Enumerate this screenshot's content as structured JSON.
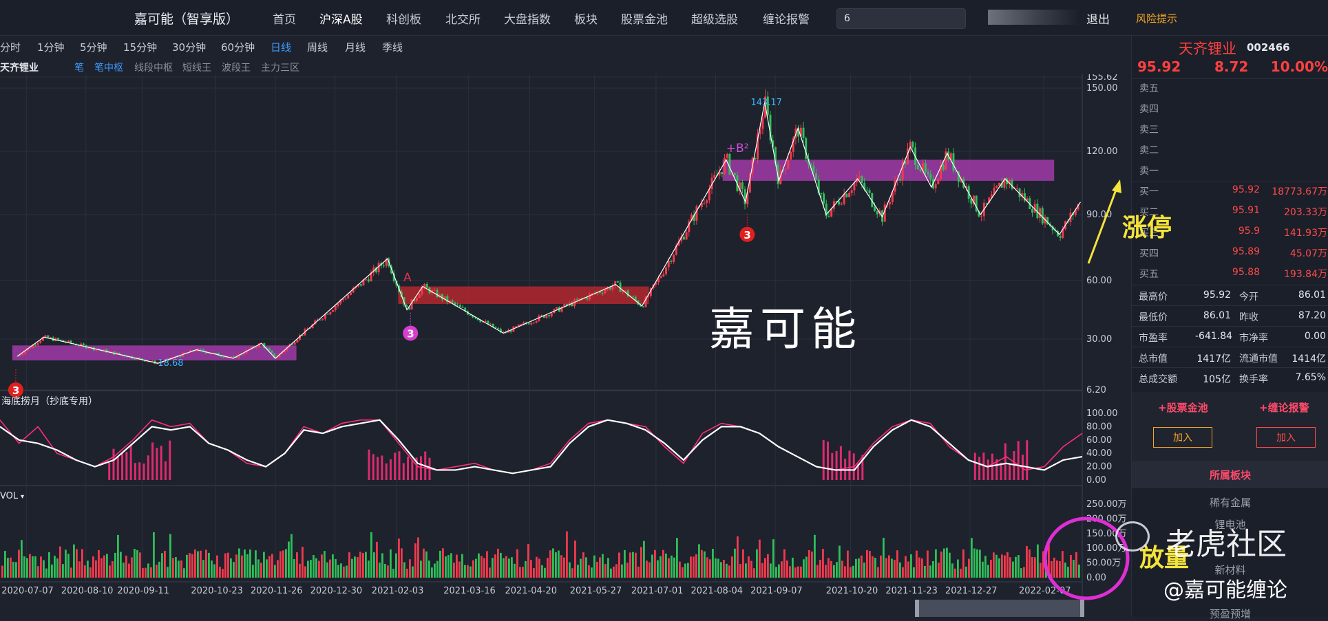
{
  "header": {
    "brand": "嘉可能（智享版）",
    "nav": [
      "首页",
      "沪深A股",
      "科创板",
      "北交所",
      "大盘指数",
      "板块",
      "股票金池",
      "超级选股",
      "缠论报警"
    ],
    "active_nav": "沪深A股",
    "search_value": "6",
    "logout": "退出",
    "risk": "风险提示"
  },
  "periods": [
    "分时",
    "1分钟",
    "5分钟",
    "15分钟",
    "30分钟",
    "60分钟",
    "日线",
    "周线",
    "月线",
    "季线"
  ],
  "active_period": "日线",
  "indicator_bar": {
    "stock": "天齐锂业",
    "items": [
      "笔",
      "笔中枢",
      "线段中枢",
      "短线王",
      "波段王",
      "主力三区"
    ],
    "active": [
      "笔",
      "笔中枢"
    ]
  },
  "chart_data": [
    {
      "type": "candlestick",
      "title": "天齐锂业",
      "y_ticks": [
        "155.62",
        "150.00",
        "120.00",
        "90.00",
        "60.00",
        "30.00",
        "6.20"
      ],
      "y_tick_values": [
        155.62,
        150,
        120,
        90,
        60,
        30,
        6.2
      ],
      "bi_points": [
        {
          "date": "2020-07-02",
          "price": 22
        },
        {
          "date": "2020-07-17",
          "price": 31
        },
        {
          "date": "2020-09-20",
          "price": 18.68
        },
        {
          "date": "2020-10-12",
          "price": 25
        },
        {
          "date": "2020-11-02",
          "price": 21
        },
        {
          "date": "2020-11-18",
          "price": 28
        },
        {
          "date": "2020-11-26",
          "price": 21
        },
        {
          "date": "2021-01-29",
          "price": 70
        },
        {
          "date": "2021-02-09",
          "price": 45
        },
        {
          "date": "2021-02-18",
          "price": 57
        },
        {
          "date": "2021-04-05",
          "price": 33
        },
        {
          "date": "2021-06-08",
          "price": 58
        },
        {
          "date": "2021-06-23",
          "price": 47
        },
        {
          "date": "2021-08-10",
          "price": 116
        },
        {
          "date": "2021-08-21",
          "price": 96
        },
        {
          "date": "2021-09-01",
          "price": 143.17
        },
        {
          "date": "2021-09-09",
          "price": 106
        },
        {
          "date": "2021-09-20",
          "price": 131
        },
        {
          "date": "2021-10-06",
          "price": 90
        },
        {
          "date": "2021-10-24",
          "price": 107
        },
        {
          "date": "2021-11-07",
          "price": 89
        },
        {
          "date": "2021-11-23",
          "price": 122
        },
        {
          "date": "2021-12-05",
          "price": 103
        },
        {
          "date": "2021-12-14",
          "price": 119
        },
        {
          "date": "2022-01-02",
          "price": 90
        },
        {
          "date": "2022-01-16",
          "price": 107
        },
        {
          "date": "2022-02-16",
          "price": 81
        },
        {
          "date": "2022-02-28",
          "price": 95.92
        }
      ],
      "zones": [
        {
          "start": "2020-06-29",
          "end": "2020-12-08",
          "low": 20,
          "high": 27,
          "color": "#a13aa8"
        },
        {
          "start": "2021-02-04",
          "end": "2021-06-27",
          "low": 48,
          "high": 57,
          "color": "#b1272f"
        },
        {
          "start": "2021-08-08",
          "end": "2022-02-13",
          "low": 106,
          "high": 116,
          "color": "#a13aa8"
        }
      ],
      "annotations": [
        {
          "text": "143.17",
          "date": "2021-08-24",
          "price": 143.17,
          "color": "#3db4ff"
        },
        {
          "text": "18.68",
          "date": "2020-09-20",
          "price": 18.68,
          "color": "#3db4ff"
        },
        {
          "text": "+B²",
          "date": "2021-08-10",
          "price": 121,
          "color": "#d04fd6"
        },
        {
          "text": "A",
          "date": "2021-02-07",
          "price": 61,
          "color": "#e0314b"
        }
      ],
      "markers": [
        {
          "label": "3",
          "date": "2021-02-11",
          "price": 33,
          "color": "#d43fcf"
        },
        {
          "label": "3",
          "date": "2021-08-22",
          "price": 81,
          "color": "#e21f1f"
        },
        {
          "label": "3",
          "date": "2020-07-01",
          "price": 6.2,
          "color": "#e21f1f"
        }
      ]
    },
    {
      "type": "line",
      "title": "海底捞月（抄底专用）",
      "y_ticks": [
        "100.00",
        "80.00",
        "60.00",
        "40.00",
        "20.00",
        "0.00"
      ],
      "ylim": [
        0,
        100
      ],
      "series": [
        {
          "color": "#ff2d7a",
          "values": [
            90,
            55,
            80,
            40,
            30,
            20,
            35,
            60,
            90,
            80,
            85,
            55,
            45,
            25,
            20,
            40,
            80,
            70,
            85,
            90,
            90,
            55,
            20,
            15,
            20,
            25,
            15,
            10,
            15,
            25,
            60,
            85,
            90,
            85,
            80,
            50,
            25,
            70,
            85,
            80,
            70,
            50,
            35,
            20,
            15,
            20,
            55,
            80,
            90,
            85,
            50,
            30,
            20,
            35,
            15,
            20,
            50,
            70
          ]
        },
        {
          "color": "#ffffff",
          "values": [
            80,
            60,
            55,
            45,
            30,
            20,
            30,
            55,
            80,
            75,
            80,
            55,
            45,
            30,
            20,
            40,
            75,
            70,
            80,
            85,
            90,
            60,
            25,
            15,
            15,
            20,
            15,
            10,
            15,
            20,
            55,
            80,
            90,
            85,
            75,
            55,
            30,
            60,
            80,
            80,
            70,
            50,
            35,
            20,
            15,
            15,
            50,
            75,
            90,
            80,
            55,
            30,
            20,
            25,
            20,
            15,
            30,
            35
          ]
        }
      ],
      "bars_near_zero": [
        [
          0.1,
          0.16
        ],
        [
          0.34,
          0.4
        ],
        [
          0.76,
          0.8
        ],
        [
          0.9,
          0.95
        ]
      ]
    },
    {
      "type": "bar",
      "title": "VOL",
      "y_ticks": [
        "250.00万",
        "200.00万",
        "150.00万",
        "100.00万",
        "50.00万",
        "0.00"
      ],
      "ylim": [
        0,
        250
      ],
      "unit": "万",
      "x_ticks": [
        "2020-07-07",
        "2020-08-10",
        "2020-09-11",
        "2020-10-23",
        "2020-11-26",
        "2020-12-30",
        "2021-02-03",
        "2021-03-16",
        "2021-04-20",
        "2021-05-27",
        "2021-07-01",
        "2021-08-04",
        "2021-09-07",
        "2021-10-20",
        "2021-11-23",
        "2021-12-27",
        "2022-02-07"
      ]
    }
  ],
  "right_panel": {
    "name": "天齐锂业",
    "code": "002466",
    "price": "95.92",
    "change": "8.72",
    "pct": "10.00%",
    "sells": [
      {
        "label": "卖五",
        "price": "",
        "vol": ""
      },
      {
        "label": "卖四",
        "price": "",
        "vol": ""
      },
      {
        "label": "卖三",
        "price": "",
        "vol": ""
      },
      {
        "label": "卖二",
        "price": "",
        "vol": ""
      },
      {
        "label": "卖一",
        "price": "",
        "vol": ""
      }
    ],
    "buys": [
      {
        "label": "买一",
        "price": "95.92",
        "vol": "18773.67万"
      },
      {
        "label": "买二",
        "price": "95.91",
        "vol": "203.33万"
      },
      {
        "label": "买三",
        "price": "95.9",
        "vol": "141.93万"
      },
      {
        "label": "买四",
        "price": "95.89",
        "vol": "45.07万"
      },
      {
        "label": "买五",
        "price": "95.88",
        "vol": "193.84万"
      }
    ],
    "stats": [
      {
        "l1": "最高价",
        "v1": "95.92",
        "l2": "今开",
        "v2": "86.01"
      },
      {
        "l1": "最低价",
        "v1": "86.01",
        "l2": "昨收",
        "v2": "87.20"
      },
      {
        "l1": "市盈率",
        "v1": "-641.84",
        "l2": "市净率",
        "v2": "0.00"
      },
      {
        "l1": "总市值",
        "v1": "1417亿",
        "l2": "流通市值",
        "v2": "1414亿"
      },
      {
        "l1": "总成交额",
        "v1": "105亿",
        "l2": "换手率",
        "v2": "7.65%"
      }
    ],
    "pool_label": "+股票金池",
    "alarm_label": "+缠论报警",
    "add_label": "加入",
    "sector_title": "所属板块",
    "sectors": [
      "稀有金属",
      "锂电池",
      "新材料",
      "预盈预增"
    ]
  },
  "overlays": {
    "watermark": "嘉可能",
    "limit_up": "涨停",
    "volume_up": "放量",
    "community": "老虎社区",
    "handle": "@嘉可能缠论"
  },
  "colors": {
    "up": "#f23a4d",
    "down": "#2fbf5a",
    "background": "#1e222d",
    "accent": "#3d9bff"
  }
}
